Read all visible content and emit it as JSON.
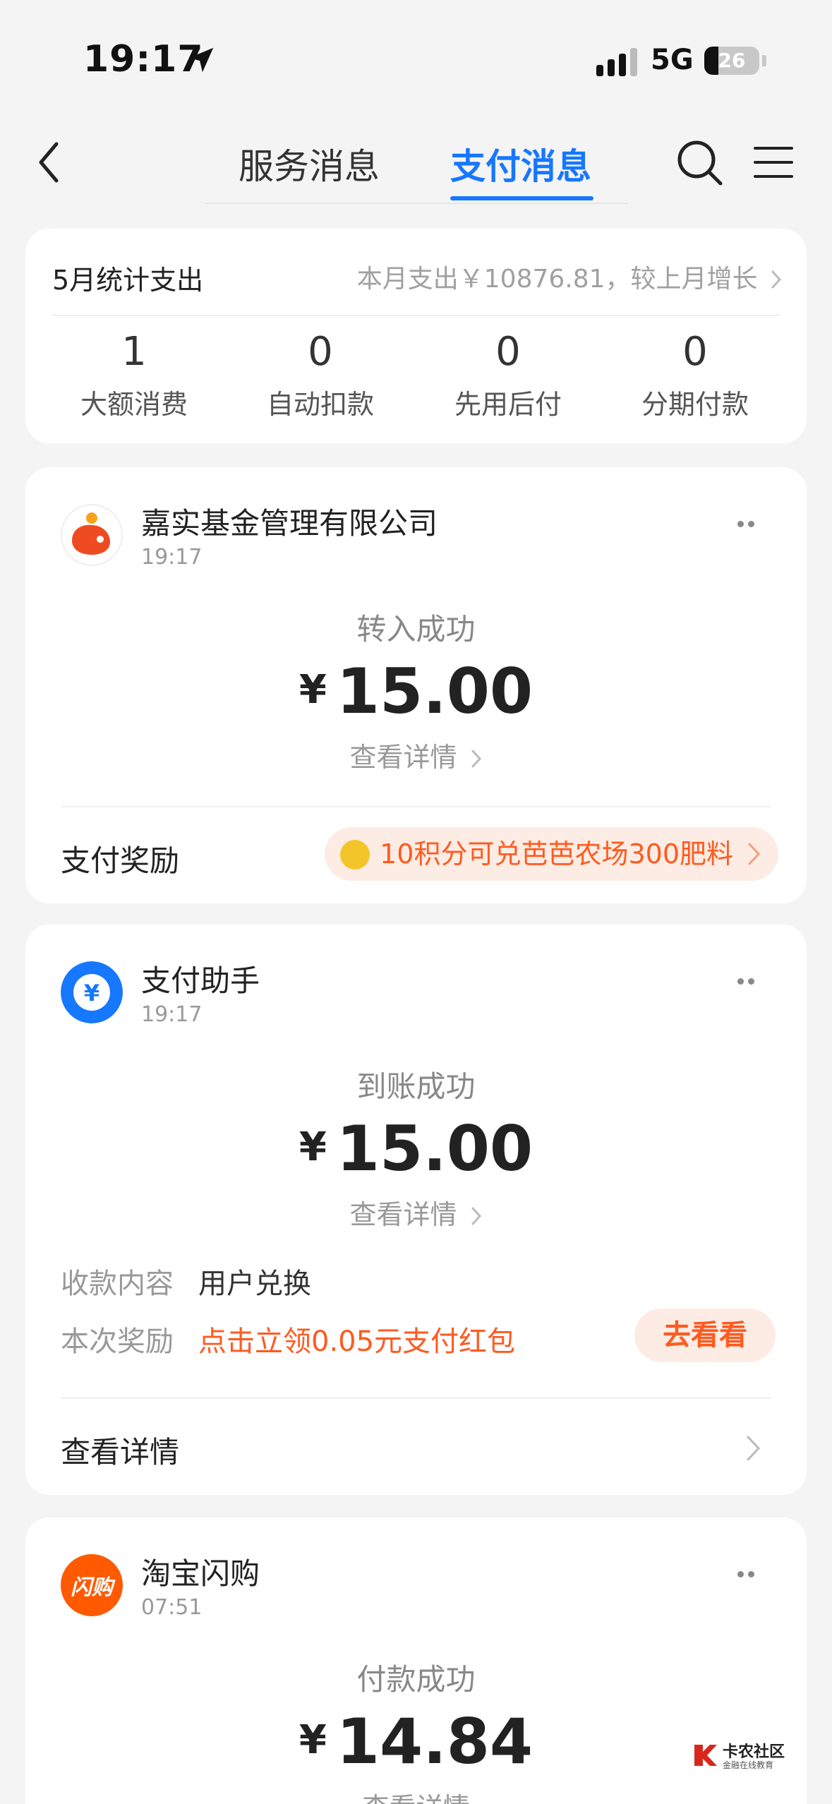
{
  "status_bar": {
    "time": "19:17",
    "network": "5G",
    "battery": "26",
    "battery_level": 0.26
  },
  "nav": {
    "tabs": [
      {
        "label": "服务消息"
      },
      {
        "label": "支付消息"
      }
    ],
    "active_tab": "支付消息"
  },
  "summary": {
    "title": "5月统计支出",
    "right_text": "本月支出￥10876.81，较上月增长",
    "stats": [
      {
        "value": "1",
        "label": "大额消费"
      },
      {
        "value": "0",
        "label": "自动扣款"
      },
      {
        "value": "0",
        "label": "先用后付"
      },
      {
        "value": "0",
        "label": "分期付款"
      }
    ]
  },
  "messages": [
    {
      "merchant": "嘉实基金管理有限公司",
      "time": "19:17",
      "status": "转入成功",
      "currency": "¥",
      "amount": "15.00",
      "detail_link": "查看详情",
      "reward_label": "支付奖励",
      "reward_text": "10积分可兑芭芭农场300肥料"
    },
    {
      "merchant": "支付助手",
      "time": "19:17",
      "status": "到账成功",
      "currency": "¥",
      "amount": "15.00",
      "detail_link": "查看详情",
      "content_key": "收款内容",
      "content_value": "用户兑换",
      "reward_key": "本次奖励",
      "reward_value": "点击立领0.05元支付红包",
      "reward_button": "去看看",
      "view_all": "查看详情"
    },
    {
      "merchant": "淘宝闪购",
      "time": "07:51",
      "status": "付款成功",
      "currency": "¥",
      "amount": "14.84",
      "detail_link": "查看详情",
      "logo_text": "闪购"
    }
  ],
  "watermark": {
    "title": "卡农社区",
    "subtitle": "金融在线教育"
  },
  "colors": {
    "accent": "#1677ff",
    "orange": "#ff5a1f"
  }
}
